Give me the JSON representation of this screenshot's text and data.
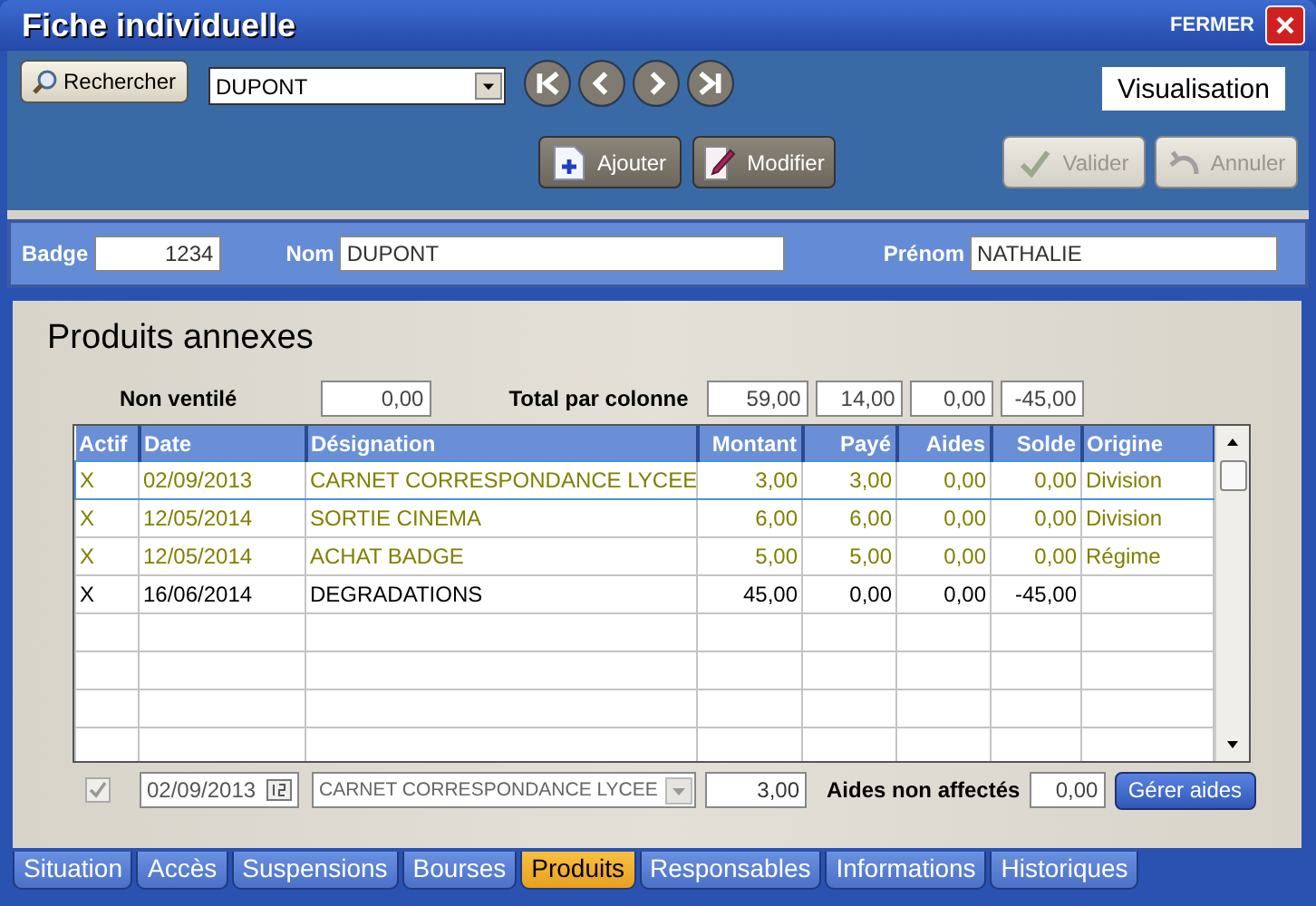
{
  "window": {
    "title": "Fiche individuelle",
    "close_label": "FERMER"
  },
  "toolbar": {
    "search_button": "Rechercher",
    "name_select": "DUPONT",
    "mode": "Visualisation",
    "buttons": [
      {
        "label": "Ajouter",
        "kind": "add",
        "disabled": false
      },
      {
        "label": "Modifier",
        "kind": "edit",
        "disabled": false
      },
      {
        "label": "Valider",
        "kind": "validate",
        "disabled": true
      },
      {
        "label": "Annuler",
        "kind": "cancel",
        "disabled": true
      }
    ]
  },
  "identity": [
    {
      "label": "Badge",
      "value": "1234",
      "kind": "number"
    },
    {
      "label": "Nom",
      "value": "DUPONT",
      "kind": "text"
    },
    {
      "label": "Prénom",
      "value": "NATHALIE",
      "kind": "text"
    }
  ],
  "section_title": "Produits annexes",
  "totals": {
    "non_ventile_label": "Non ventilé",
    "non_ventile": "0,00",
    "total_label": "Total par colonne",
    "values": [
      "59,00",
      "14,00",
      "0,00",
      "-45,00"
    ]
  },
  "table": {
    "columns": [
      "Actif",
      "Date",
      "Désignation",
      "Montant",
      "Payé",
      "Aides",
      "Solde",
      "Origine"
    ],
    "rows": [
      {
        "cells": [
          "X",
          "02/09/2013",
          "CARNET CORRESPONDANCE LYCEE",
          "3,00",
          "3,00",
          "0,00",
          "0,00",
          "Division"
        ],
        "color": "#808000",
        "selected": true
      },
      {
        "cells": [
          "X",
          "12/05/2014",
          "SORTIE CINEMA",
          "6,00",
          "6,00",
          "0,00",
          "0,00",
          "Division"
        ],
        "color": "#808000",
        "selected": false
      },
      {
        "cells": [
          "X",
          "12/05/2014",
          "ACHAT BADGE",
          "5,00",
          "5,00",
          "0,00",
          "0,00",
          "Régime"
        ],
        "color": "#808000",
        "selected": false
      },
      {
        "cells": [
          "X",
          "16/06/2014",
          "DEGRADATIONS",
          "45,00",
          "0,00",
          "0,00",
          "-45,00",
          ""
        ],
        "color": "#000000",
        "selected": false
      }
    ]
  },
  "editor": {
    "checked": true,
    "date": "02/09/2013",
    "designation": "CARNET CORRESPONDANCE LYCEE",
    "montant": "3,00",
    "aides_label": "Aides non affectés",
    "aides_value": "0,00",
    "button": "Gérer aides"
  },
  "tabs": [
    {
      "label": "Situation",
      "selected": false
    },
    {
      "label": "Accès",
      "selected": false
    },
    {
      "label": "Suspensions",
      "selected": false
    },
    {
      "label": "Bourses",
      "selected": false
    },
    {
      "label": "Produits",
      "selected": true
    },
    {
      "label": "Responsables",
      "selected": false
    },
    {
      "label": "Informations",
      "selected": false
    },
    {
      "label": "Historiques",
      "selected": false
    }
  ]
}
